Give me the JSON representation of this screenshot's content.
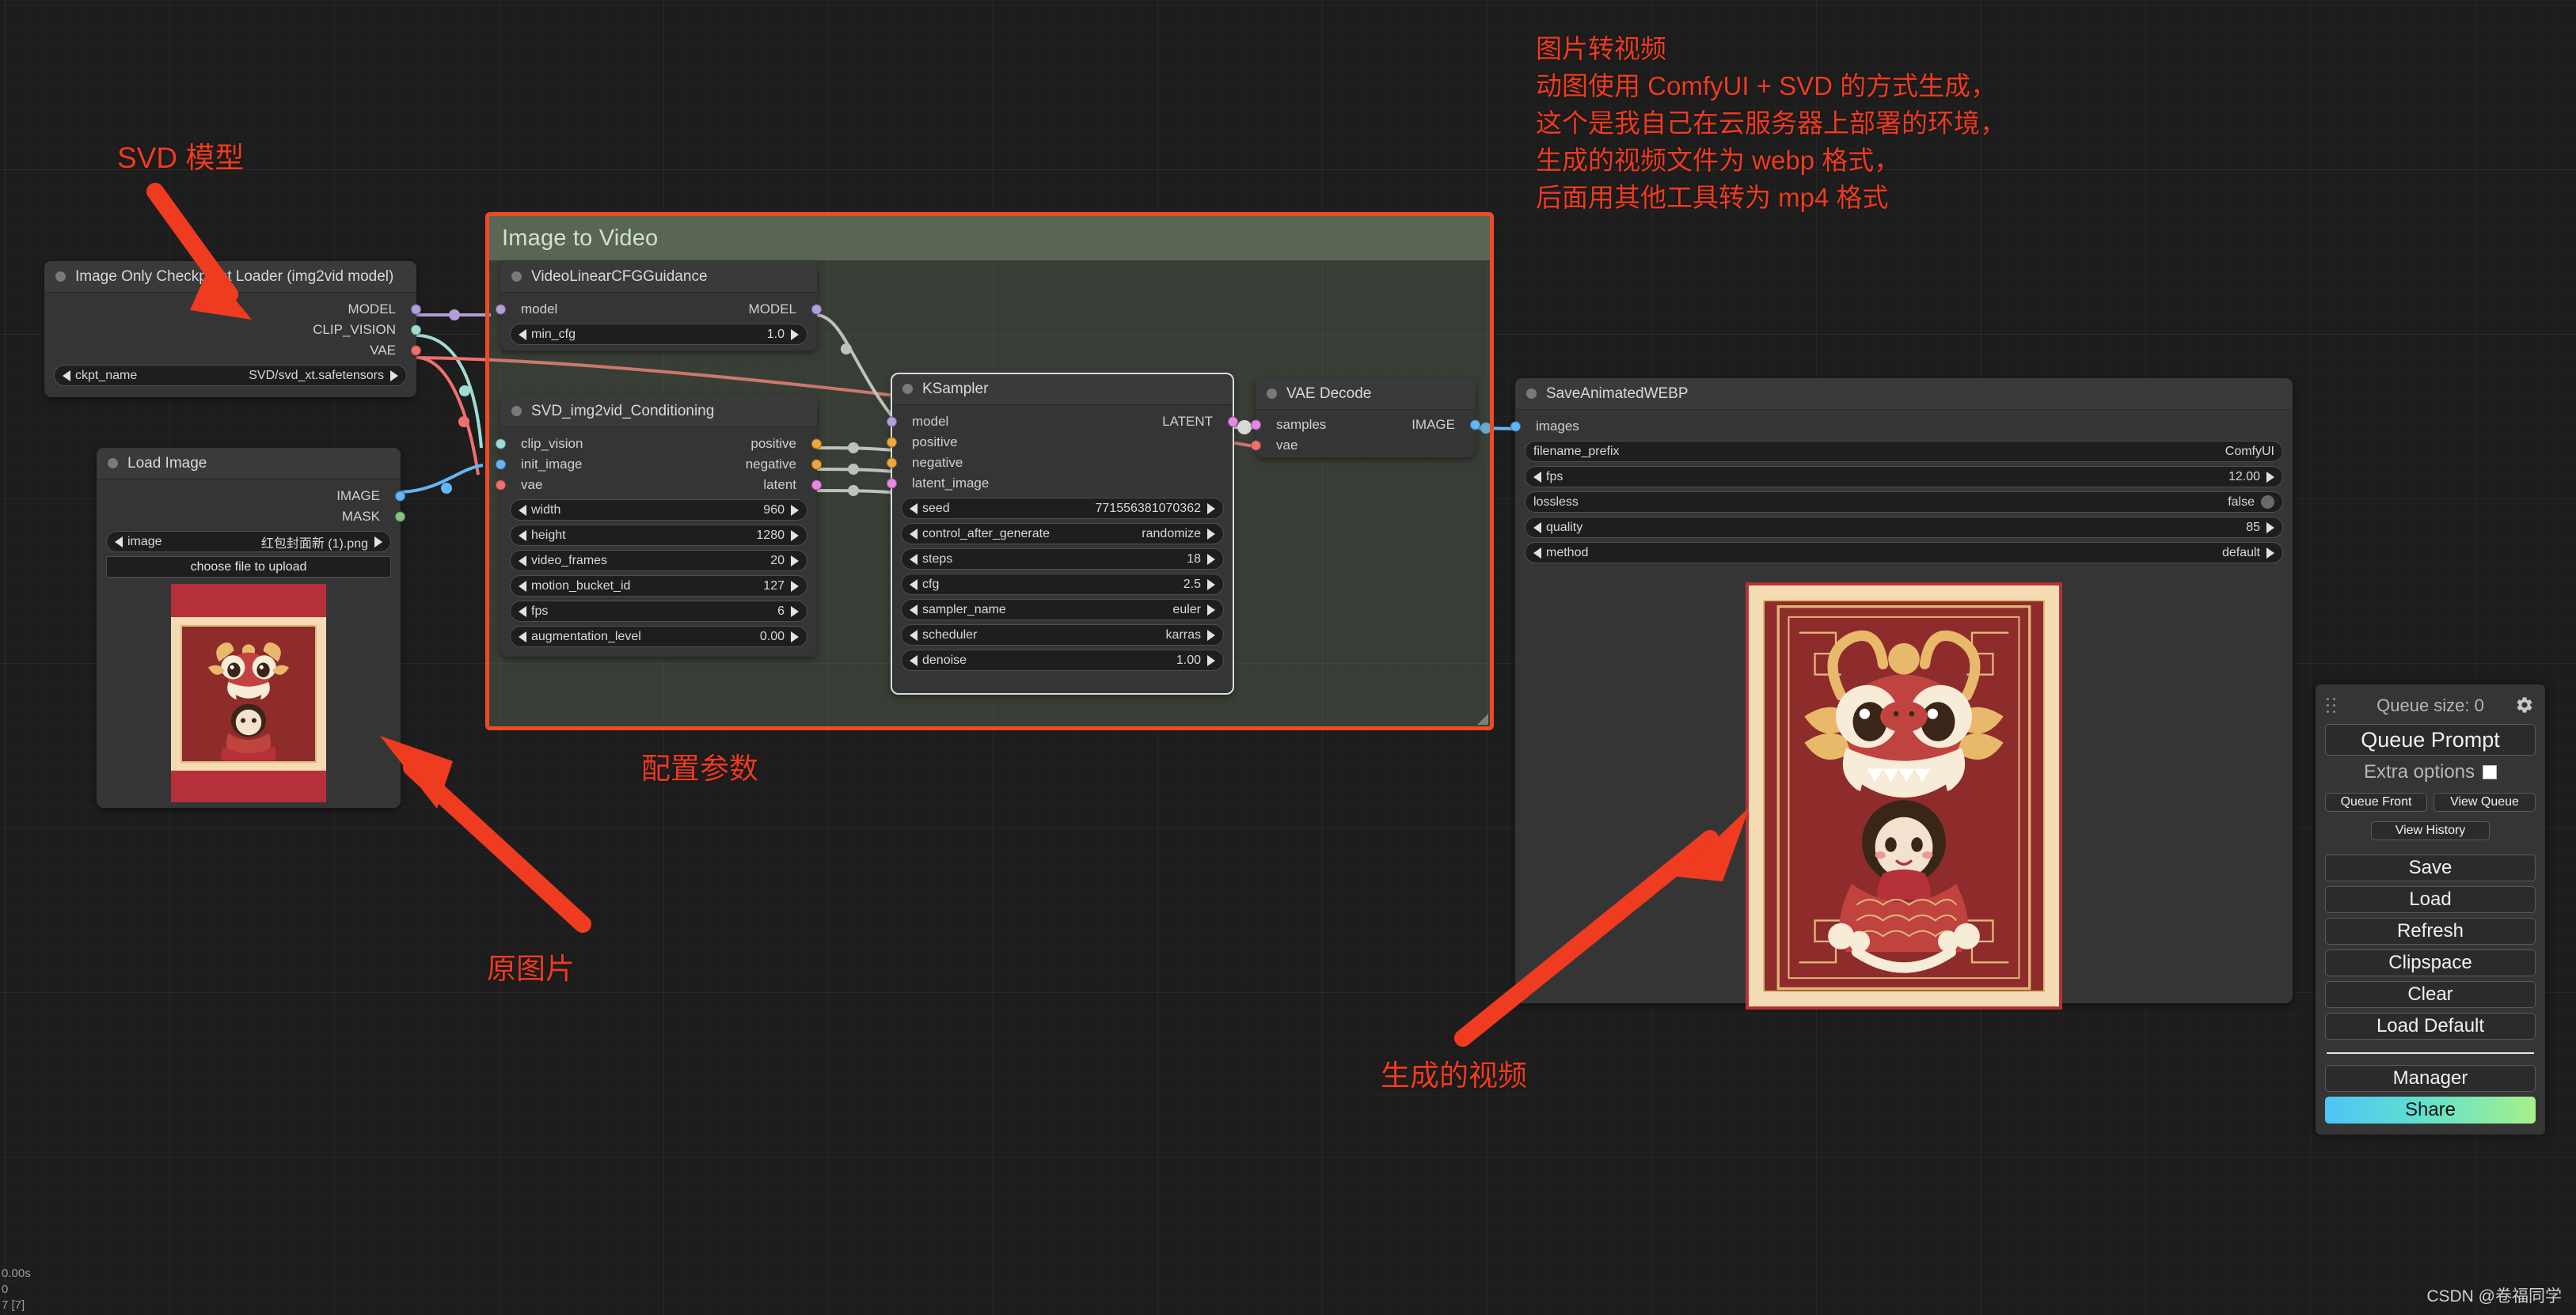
{
  "app": {
    "name": "ComfyUI",
    "canvas_background": "#1d1d1d",
    "accent": "#ef3b1f"
  },
  "group": {
    "title": "Image to Video",
    "color": "#768c70",
    "border_color": "#ef4a23"
  },
  "nodes": {
    "checkpoint_loader": {
      "title": "Image Only Checkpoint Loader (img2vid model)",
      "outputs": [
        {
          "label": "MODEL",
          "color": "#b39ddb"
        },
        {
          "label": "CLIP_VISION",
          "color": "#9fdcd4"
        },
        {
          "label": "VAE",
          "color": "#f0706e"
        }
      ],
      "widgets": [
        {
          "name": "ckpt_name",
          "value": "SVD/svd_xt.safetensors",
          "type": "combo"
        }
      ]
    },
    "load_image": {
      "title": "Load Image",
      "outputs": [
        {
          "label": "IMAGE",
          "color": "#64b5f6"
        },
        {
          "label": "MASK",
          "color": "#81c784"
        }
      ],
      "widgets": [
        {
          "name": "image",
          "value": "红包封面新 (1).png",
          "type": "combo"
        }
      ],
      "upload_button": "choose file to upload"
    },
    "video_linear_cfg": {
      "title": "VideoLinearCFGGuidance",
      "inputs": [
        {
          "label": "model",
          "color": "#b39ddb"
        }
      ],
      "outputs": [
        {
          "label": "MODEL",
          "color": "#b39ddb"
        }
      ],
      "widgets": [
        {
          "name": "min_cfg",
          "value": "1.0",
          "type": "number"
        }
      ]
    },
    "svd_conditioning": {
      "title": "SVD_img2vid_Conditioning",
      "inputs": [
        {
          "label": "clip_vision",
          "color": "#9fdcd4"
        },
        {
          "label": "init_image",
          "color": "#64b5f6"
        },
        {
          "label": "vae",
          "color": "#f0706e"
        }
      ],
      "outputs": [
        {
          "label": "positive",
          "color": "#f0a73a"
        },
        {
          "label": "negative",
          "color": "#f0a73a"
        },
        {
          "label": "latent",
          "color": "#e986e9"
        }
      ],
      "widgets": [
        {
          "name": "width",
          "value": "960",
          "type": "number"
        },
        {
          "name": "height",
          "value": "1280",
          "type": "number"
        },
        {
          "name": "video_frames",
          "value": "20",
          "type": "number"
        },
        {
          "name": "motion_bucket_id",
          "value": "127",
          "type": "number"
        },
        {
          "name": "fps",
          "value": "6",
          "type": "number"
        },
        {
          "name": "augmentation_level",
          "value": "0.00",
          "type": "number"
        }
      ]
    },
    "ksampler": {
      "title": "KSampler",
      "inputs": [
        {
          "label": "model",
          "color": "#b39ddb"
        },
        {
          "label": "positive",
          "color": "#f0a73a"
        },
        {
          "label": "negative",
          "color": "#f0a73a"
        },
        {
          "label": "latent_image",
          "color": "#e986e9"
        }
      ],
      "outputs": [
        {
          "label": "LATENT",
          "color": "#e986e9"
        }
      ],
      "widgets": [
        {
          "name": "seed",
          "value": "771556381070362",
          "type": "number"
        },
        {
          "name": "control_after_generate",
          "value": "randomize",
          "type": "combo"
        },
        {
          "name": "steps",
          "value": "18",
          "type": "number"
        },
        {
          "name": "cfg",
          "value": "2.5",
          "type": "number"
        },
        {
          "name": "sampler_name",
          "value": "euler",
          "type": "combo"
        },
        {
          "name": "scheduler",
          "value": "karras",
          "type": "combo"
        },
        {
          "name": "denoise",
          "value": "1.00",
          "type": "number"
        }
      ]
    },
    "vae_decode": {
      "title": "VAE Decode",
      "inputs": [
        {
          "label": "samples",
          "color": "#e986e9"
        },
        {
          "label": "vae",
          "color": "#f0706e"
        }
      ],
      "outputs": [
        {
          "label": "IMAGE",
          "color": "#64b5f6"
        }
      ]
    },
    "save_animated_webp": {
      "title": "SaveAnimatedWEBP",
      "inputs": [
        {
          "label": "images",
          "color": "#64b5f6"
        }
      ],
      "widgets": [
        {
          "name": "filename_prefix",
          "value": "ComfyUI",
          "type": "text"
        },
        {
          "name": "fps",
          "value": "12.00",
          "type": "number"
        },
        {
          "name": "lossless",
          "value": "false",
          "type": "toggle"
        },
        {
          "name": "quality",
          "value": "85",
          "type": "number"
        },
        {
          "name": "method",
          "value": "default",
          "type": "combo"
        }
      ]
    }
  },
  "annotations": {
    "svd_model": "SVD 模型",
    "config_params": "配置参数",
    "source_image": "原图片",
    "generated_video": "生成的视频",
    "note": "图片转视频\n动图使用 ComfyUI + SVD 的方式生成，\n这个是我自己在云服务器上部署的环境，\n生成的视频文件为 webp 格式，\n后面用其他工具转为 mp4 格式"
  },
  "menu": {
    "queue_size_label": "Queue size: 0",
    "queue_prompt": "Queue Prompt",
    "extra_options": "Extra options",
    "queue_front": "Queue Front",
    "view_queue": "View Queue",
    "view_history": "View History",
    "save": "Save",
    "load": "Load",
    "refresh": "Refresh",
    "clipspace": "Clipspace",
    "clear": "Clear",
    "load_default": "Load Default",
    "manager": "Manager",
    "share": "Share"
  },
  "status": {
    "line1": "0.00s",
    "line2": "0",
    "line3": "7 [7]"
  },
  "watermark": "CSDN @卷福同学"
}
